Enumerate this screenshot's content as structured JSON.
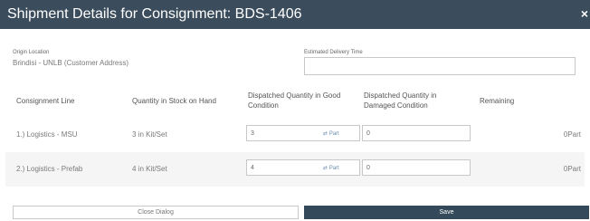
{
  "dialog": {
    "title": "Shipment Details for Consignment: BDS-1406",
    "close_symbol": "×"
  },
  "origin": {
    "label": "Origin Location",
    "value": "Brindisi - UNLB (Customer Address)"
  },
  "delivery": {
    "label": "Estimated Delivery Time",
    "value": ""
  },
  "table": {
    "headers": [
      "Consignment Line",
      "Quantity in Stock on Hand",
      "Dispatched Quantity in Good Condition",
      "Dispatched Quantity in Damaged Condition",
      "Remaining"
    ],
    "rows": [
      {
        "line": "1.) Logistics - MSU",
        "stock": "3 in Kit/Set",
        "good_qty": "3",
        "good_unit": "⇄ Part",
        "damaged_qty": "0",
        "remaining": "0Part"
      },
      {
        "line": "2.) Logistics - Prefab",
        "stock": "4 in Kit/Set",
        "good_qty": "4",
        "good_unit": "⇄ Part",
        "damaged_qty": "0",
        "remaining": "0Part"
      }
    ]
  },
  "footer": {
    "close_label": "Close Dialog",
    "save_label": "Save"
  },
  "colors": {
    "header_bg": "#3b4d5c",
    "save_bg": "#344a5a",
    "row_alt_bg": "#f5f5f5"
  }
}
